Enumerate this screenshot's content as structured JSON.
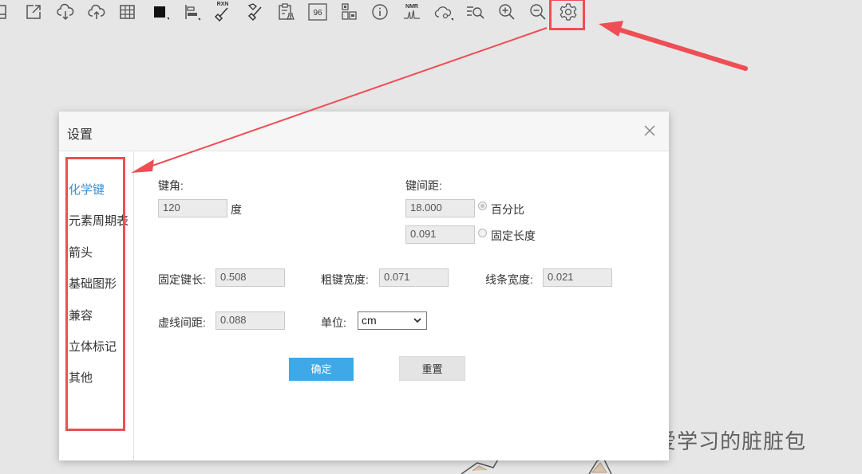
{
  "toolbar": {
    "items": [
      {
        "name": "save-icon"
      },
      {
        "name": "export-icon"
      },
      {
        "name": "cloud-download-icon"
      },
      {
        "name": "cloud-upload-icon"
      },
      {
        "name": "grid-icon"
      },
      {
        "name": "color-fill-icon",
        "color": "#111111"
      },
      {
        "name": "align-icon"
      },
      {
        "name": "reaction-clean-icon",
        "label": "RXN"
      },
      {
        "name": "structure-clean-icon"
      },
      {
        "name": "clipboard-flask-icon"
      },
      {
        "name": "plate-96-icon",
        "label": "96"
      },
      {
        "name": "qr-code-icon"
      },
      {
        "name": "info-icon"
      },
      {
        "name": "nmr-icon",
        "label": "NMR"
      },
      {
        "name": "cloud-settings-icon"
      },
      {
        "name": "search-list-icon"
      },
      {
        "name": "zoom-in-icon"
      },
      {
        "name": "zoom-out-icon"
      },
      {
        "name": "settings-gear-icon"
      }
    ]
  },
  "dialog": {
    "title": "设置",
    "close_icon": "close-icon",
    "sidebar": {
      "items": [
        {
          "label": "化学键",
          "active": true
        },
        {
          "label": "元素周期表",
          "active": false
        },
        {
          "label": "箭头",
          "active": false
        },
        {
          "label": "基础图形",
          "active": false
        },
        {
          "label": "兼容",
          "active": false
        },
        {
          "label": "立体标记",
          "active": false
        },
        {
          "label": "其他",
          "active": false
        }
      ]
    },
    "bond_angle": {
      "label": "键角:",
      "value": "120",
      "unit": "度"
    },
    "bond_spacing": {
      "label": "键间距:",
      "percent_value": "18.000",
      "percent_label": "百分比",
      "percent_selected": true,
      "fixed_value": "0.091",
      "fixed_label": "固定长度",
      "fixed_selected": false
    },
    "fixed_bond_length": {
      "label": "固定键长:",
      "value": "0.508"
    },
    "bold_bond_width": {
      "label": "粗键宽度:",
      "value": "0.071"
    },
    "line_width": {
      "label": "线条宽度:",
      "value": "0.021"
    },
    "dash_spacing": {
      "label": "虚线间距:",
      "value": "0.088"
    },
    "unit": {
      "label": "单位:",
      "value": "cm"
    },
    "buttons": {
      "ok": "确定",
      "reset": "重置"
    }
  },
  "watermark": {
    "text": "公众号 · 爱学习的脏脏包"
  },
  "colors": {
    "accent": "#3fa9e8",
    "active_tab": "#3a8fd6",
    "annotation_red": "#ee4e55",
    "background": "#e6e6e6"
  }
}
